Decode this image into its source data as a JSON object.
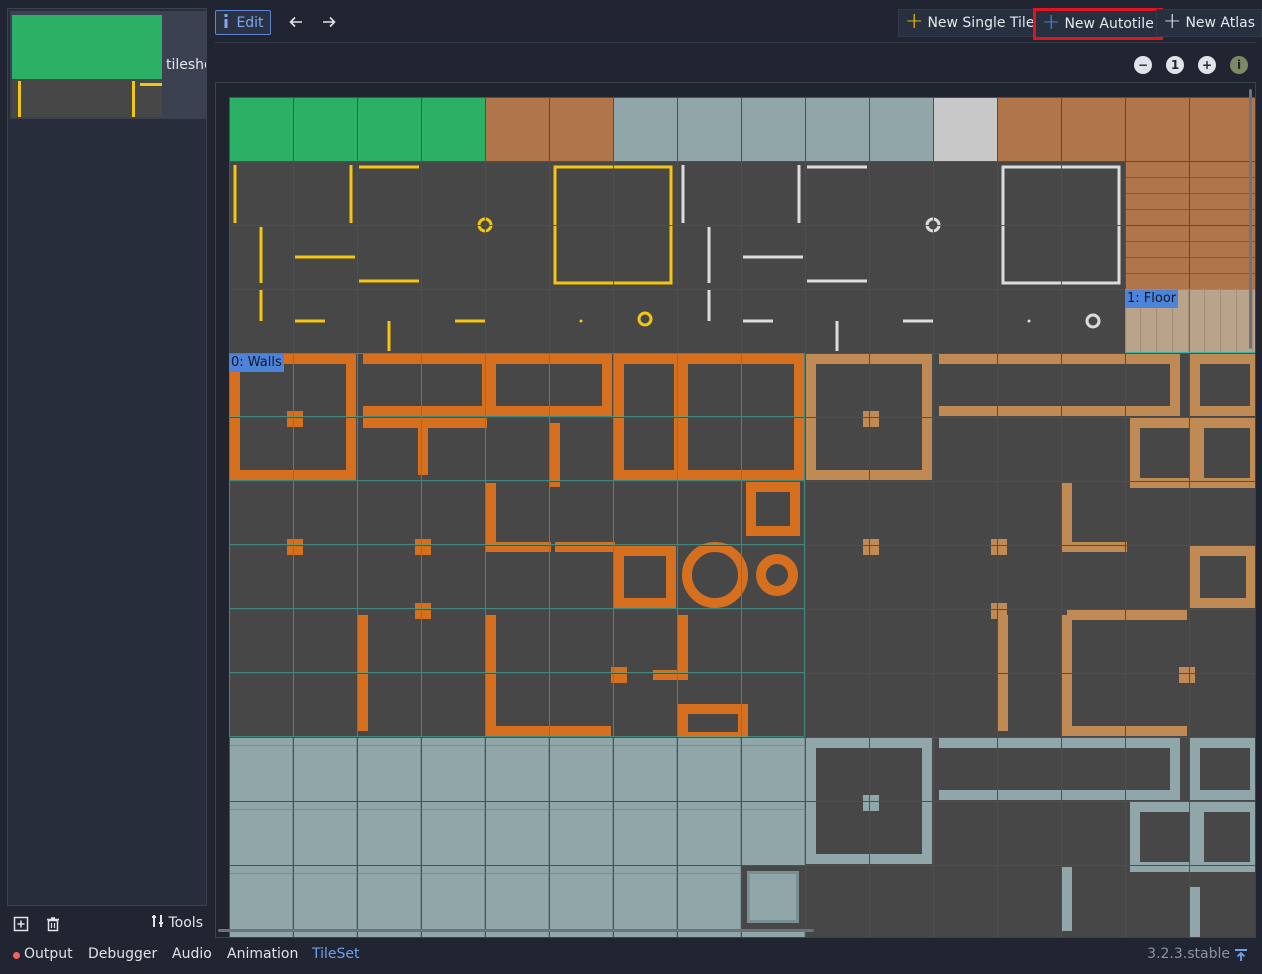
{
  "left_panel": {
    "texture_label": "tileshe",
    "tools_label": "Tools",
    "icons": [
      "add-texture-icon",
      "trash-icon",
      "tools-icon"
    ]
  },
  "toolbar": {
    "edit_label": "Edit",
    "new_single_tile": "New Single Tile",
    "new_autotile": "New Autotile",
    "new_atlas": "New Atlas",
    "highlight_color": "#e0141f"
  },
  "zoom": {
    "reset_label": "1"
  },
  "canvas": {
    "regions": [
      {
        "label": "0: Walls",
        "color": "#4d83d8"
      },
      {
        "label": "1: Floor",
        "color": "#4d83d8"
      }
    ],
    "grid_color": "#5a2fd6",
    "region_grid_color": "#3fb0a0"
  },
  "bottom": {
    "tabs": [
      "Output",
      "Debugger",
      "Audio",
      "Animation",
      "TileSet"
    ],
    "active_tab": "TileSet",
    "version": "3.2.3.stable"
  },
  "colors": {
    "accent": "#6ea0f0",
    "grass": "#2bb065",
    "dirt": "#b0754a",
    "stone": "#90a6a8",
    "wall_orange": "#d6701f",
    "wall_tan": "#c08a55",
    "yellow_line": "#f3c614"
  }
}
